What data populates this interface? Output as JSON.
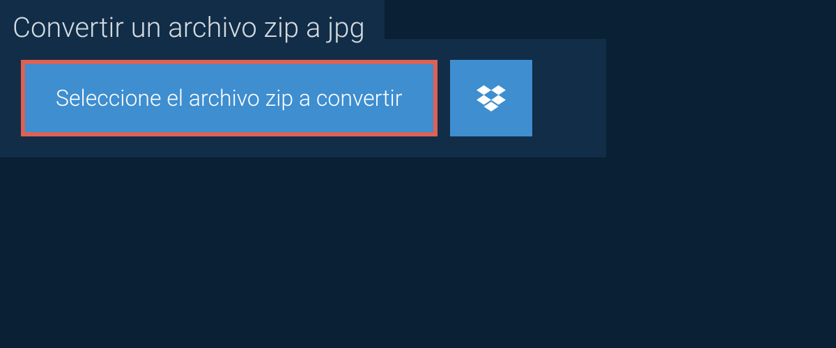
{
  "header": {
    "title": "Convertir un archivo zip a jpg"
  },
  "actions": {
    "select_file_label": "Seleccione el archivo zip a convertir",
    "dropbox_icon": "dropbox"
  },
  "colors": {
    "background": "#0a2034",
    "panel": "#122d47",
    "button": "#3e8ed0",
    "highlight_border": "#dd6155",
    "text_light": "#d5dce2",
    "text_white": "#ffffff"
  }
}
